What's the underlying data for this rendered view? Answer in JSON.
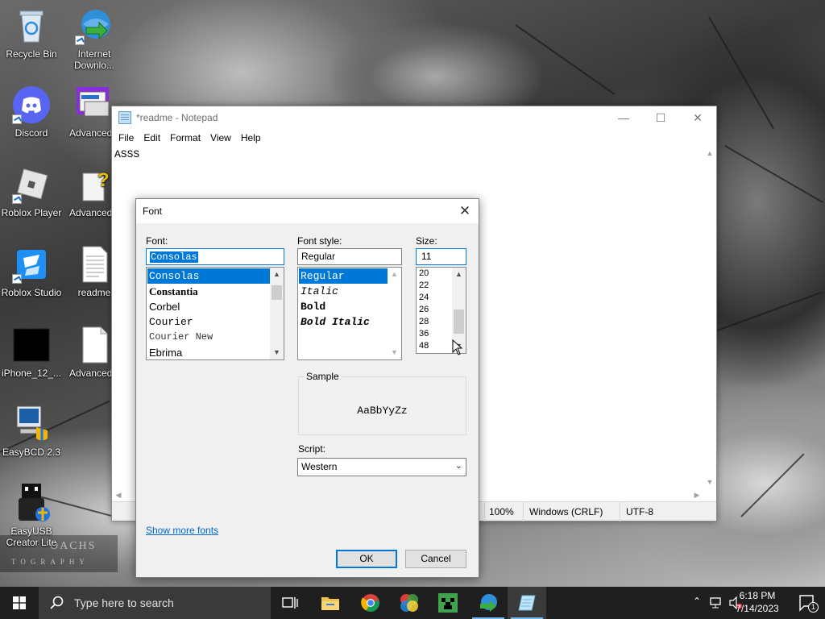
{
  "desktop_icons": [
    {
      "label": "Recycle Bin",
      "icon": "recycle-bin-icon"
    },
    {
      "label": "Internet Downlo...",
      "icon": "internet-download-manager-icon"
    },
    {
      "label": "Discord",
      "icon": "discord-icon"
    },
    {
      "label": "AdvancedR",
      "icon": "advanced-app-icon"
    },
    {
      "label": "Roblox Player",
      "icon": "roblox-player-icon"
    },
    {
      "label": "AdvancedR",
      "icon": "advanced-help-icon"
    },
    {
      "label": "Roblox Studio",
      "icon": "roblox-studio-icon"
    },
    {
      "label": "readme",
      "icon": "text-document-icon"
    },
    {
      "label": "iPhone_12_...",
      "icon": "black-image-icon"
    },
    {
      "label": "AdvancedR",
      "icon": "blank-document-icon"
    },
    {
      "label": "EasyBCD 2.3",
      "icon": "easybcd-icon"
    },
    {
      "label": "EasyUSB Creator Lite",
      "icon": "easyusb-creator-icon"
    }
  ],
  "wallpaper": {
    "watermark_line1": "OACHS",
    "watermark_line2": "TOGRAPHY"
  },
  "notepad": {
    "title": "*readme - Notepad",
    "menu": [
      "File",
      "Edit",
      "Format",
      "View",
      "Help"
    ],
    "content": "ASSS",
    "status": {
      "zoom": "100%",
      "line_ending": "Windows (CRLF)",
      "encoding": "UTF-8"
    }
  },
  "font_dialog": {
    "title": "Font",
    "font_label": "Font:",
    "font_value": "Consolas",
    "fonts": [
      "Consolas",
      "Constantia",
      "Corbel",
      "Courier",
      "Courier New",
      "Ebrima"
    ],
    "selected_font": "Consolas",
    "style_label": "Font style:",
    "style_value": "Regular",
    "styles": [
      "Regular",
      "Italic",
      "Bold",
      "Bold Italic"
    ],
    "selected_style": "Regular",
    "size_label": "Size:",
    "size_value": "11",
    "sizes": [
      "20",
      "22",
      "24",
      "26",
      "28",
      "36",
      "48"
    ],
    "sample_label": "Sample",
    "sample_text": "AaBbYyZz",
    "script_label": "Script:",
    "script_value": "Western",
    "show_more": "Show more fonts",
    "ok": "OK",
    "cancel": "Cancel"
  },
  "taskbar": {
    "search_placeholder": "Type here to search",
    "apps": [
      "task-view-icon",
      "file-explorer-icon",
      "chrome-icon",
      "color-app-icon",
      "minecraft-icon",
      "idm-icon",
      "notepad-icon"
    ],
    "time": "6:18 PM",
    "date": "7/14/2023",
    "notification_count": "1"
  },
  "colors": {
    "accent": "#0078d7",
    "taskbar": "#1f1f1f",
    "link": "#0066cc"
  }
}
